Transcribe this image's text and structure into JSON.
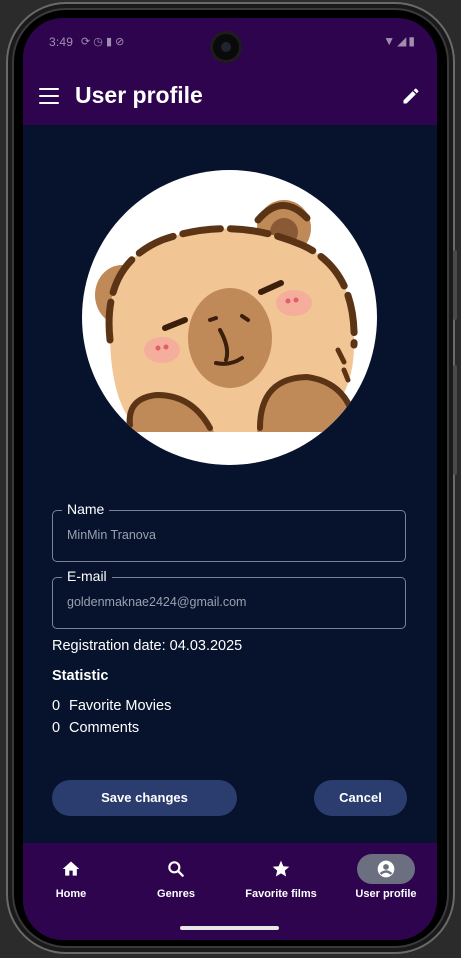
{
  "status_bar": {
    "time": "3:49",
    "icons_left": [
      "status-sync-icon",
      "status-clock-icon",
      "status-sim-icon",
      "status-block-icon"
    ],
    "icons_right": [
      "wifi-icon",
      "signal-icon",
      "battery-icon"
    ]
  },
  "app_bar": {
    "title": "User profile",
    "menu_icon": "menu-icon",
    "edit_icon": "edit-icon"
  },
  "profile": {
    "name_label": "Name",
    "name_value": "MinMin Tranova",
    "email_label": "E-mail",
    "email_value": "goldenmaknae2424@gmail.com",
    "registration": "Registration date: 04.03.2025"
  },
  "statistic": {
    "title": "Statistic",
    "items": [
      {
        "count": "0",
        "label": "Favorite Movies"
      },
      {
        "count": "0",
        "label": "Comments"
      }
    ]
  },
  "actions": {
    "save_label": "Save changes",
    "cancel_label": "Cancel"
  },
  "bottom_nav": {
    "items": [
      {
        "label": "Home",
        "icon": "home-icon",
        "active": false
      },
      {
        "label": "Genres",
        "icon": "search-icon",
        "active": false
      },
      {
        "label": "Favorite films",
        "icon": "star-icon",
        "active": false
      },
      {
        "label": "User profile",
        "icon": "account-icon",
        "active": true
      }
    ]
  },
  "colors": {
    "bar": "#2e044e",
    "background": "#07122c",
    "button": "#2a3d6e",
    "active_pill": "#6b6f80"
  }
}
